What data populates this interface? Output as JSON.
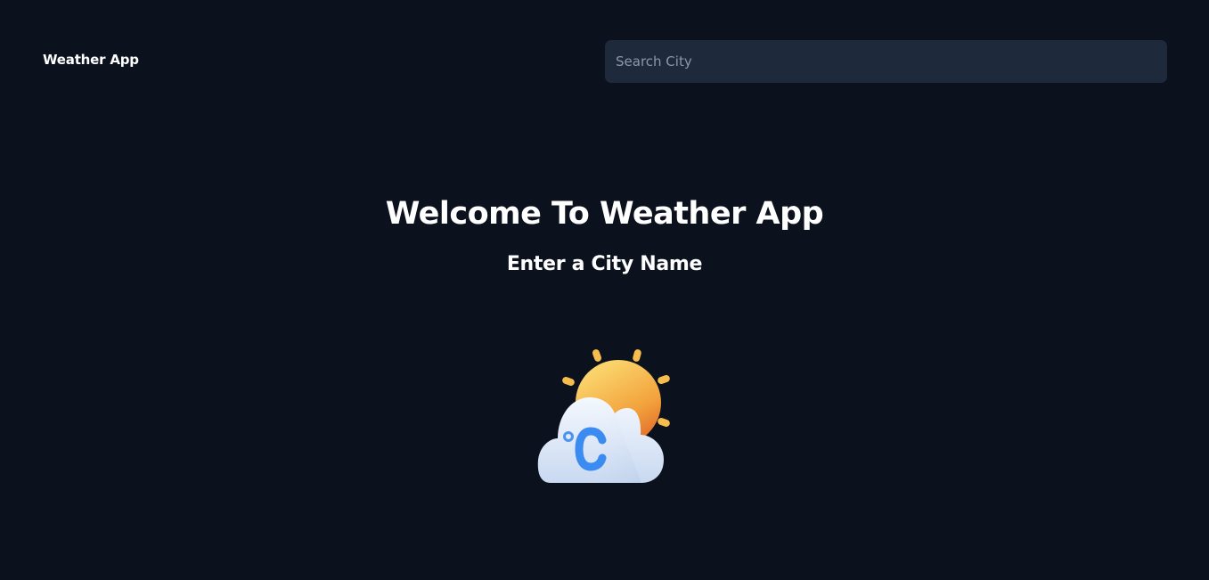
{
  "header": {
    "brand": "Weather App",
    "search": {
      "placeholder": "Search City",
      "value": ""
    }
  },
  "main": {
    "title": "Welcome To Weather App",
    "subtitle": "Enter a City Name",
    "illustration": {
      "icon": "sun-cloud-celsius-icon",
      "glyph": "°C"
    }
  },
  "colors": {
    "background": "#0b121d",
    "search_background": "#1e293b",
    "text": "#ffffff",
    "placeholder": "#8e97a6",
    "sun": "#f6b73c",
    "cloud": "#e8f0fb",
    "celsius": "#3b8bf0"
  }
}
